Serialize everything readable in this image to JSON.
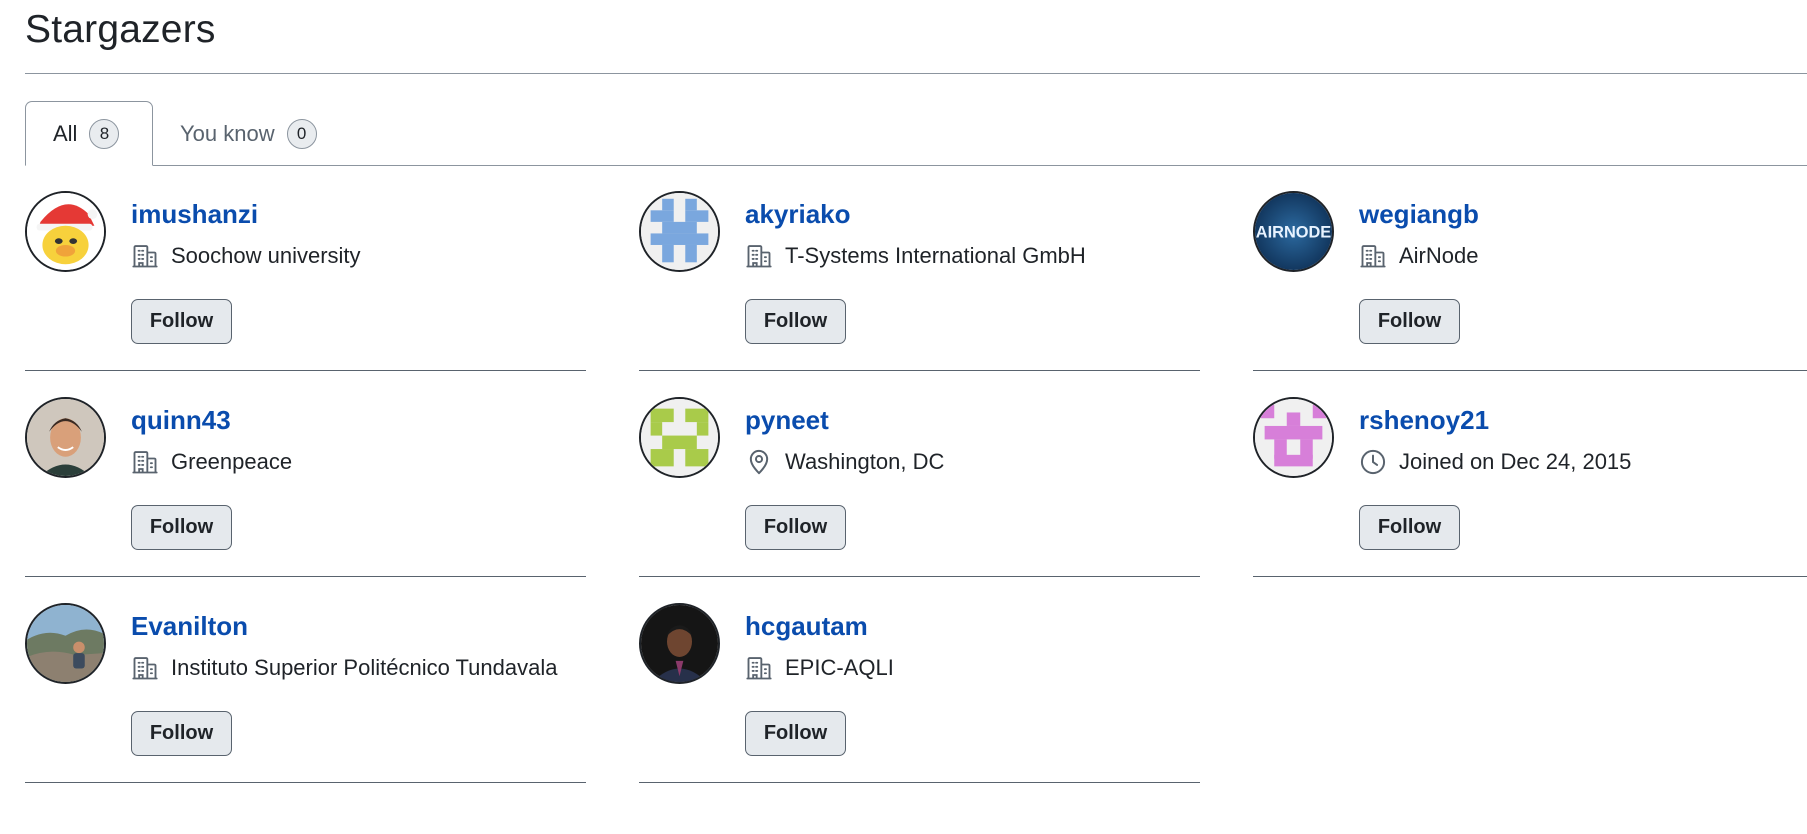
{
  "page": {
    "title": "Stargazers"
  },
  "tabs": [
    {
      "label": "All",
      "count": "8"
    },
    {
      "label": "You know",
      "count": "0"
    }
  ],
  "users": [
    {
      "login": "imushanzi",
      "meta": "Soochow university",
      "meta_icon": "organization-icon",
      "follow": "Follow"
    },
    {
      "login": "akyriako",
      "meta": "T-Systems International GmbH",
      "meta_icon": "organization-icon",
      "follow": "Follow"
    },
    {
      "login": "wegiangb",
      "meta": "AirNode",
      "meta_icon": "organization-icon",
      "follow": "Follow",
      "avatar_text": "AIRNODE"
    },
    {
      "login": "quinn43",
      "meta": "Greenpeace",
      "meta_icon": "organization-icon",
      "follow": "Follow"
    },
    {
      "login": "pyneet",
      "meta": "Washington, DC",
      "meta_icon": "location-icon",
      "follow": "Follow"
    },
    {
      "login": "rshenoy21",
      "meta": "Joined on Dec 24, 2015",
      "meta_icon": "clock-icon",
      "follow": "Follow"
    },
    {
      "login": "Evanilton",
      "meta": "Instituto Superior Politécnico Tundavala",
      "meta_icon": "organization-icon",
      "follow": "Follow"
    },
    {
      "login": "hcgautam",
      "meta": "EPIC-AQLI",
      "meta_icon": "organization-icon",
      "follow": "Follow"
    }
  ],
  "colors": {
    "link": "#0a4cad",
    "identicon_blue": "#7aa7de",
    "identicon_green": "#a9cb4a",
    "identicon_pink": "#d77fd9"
  }
}
